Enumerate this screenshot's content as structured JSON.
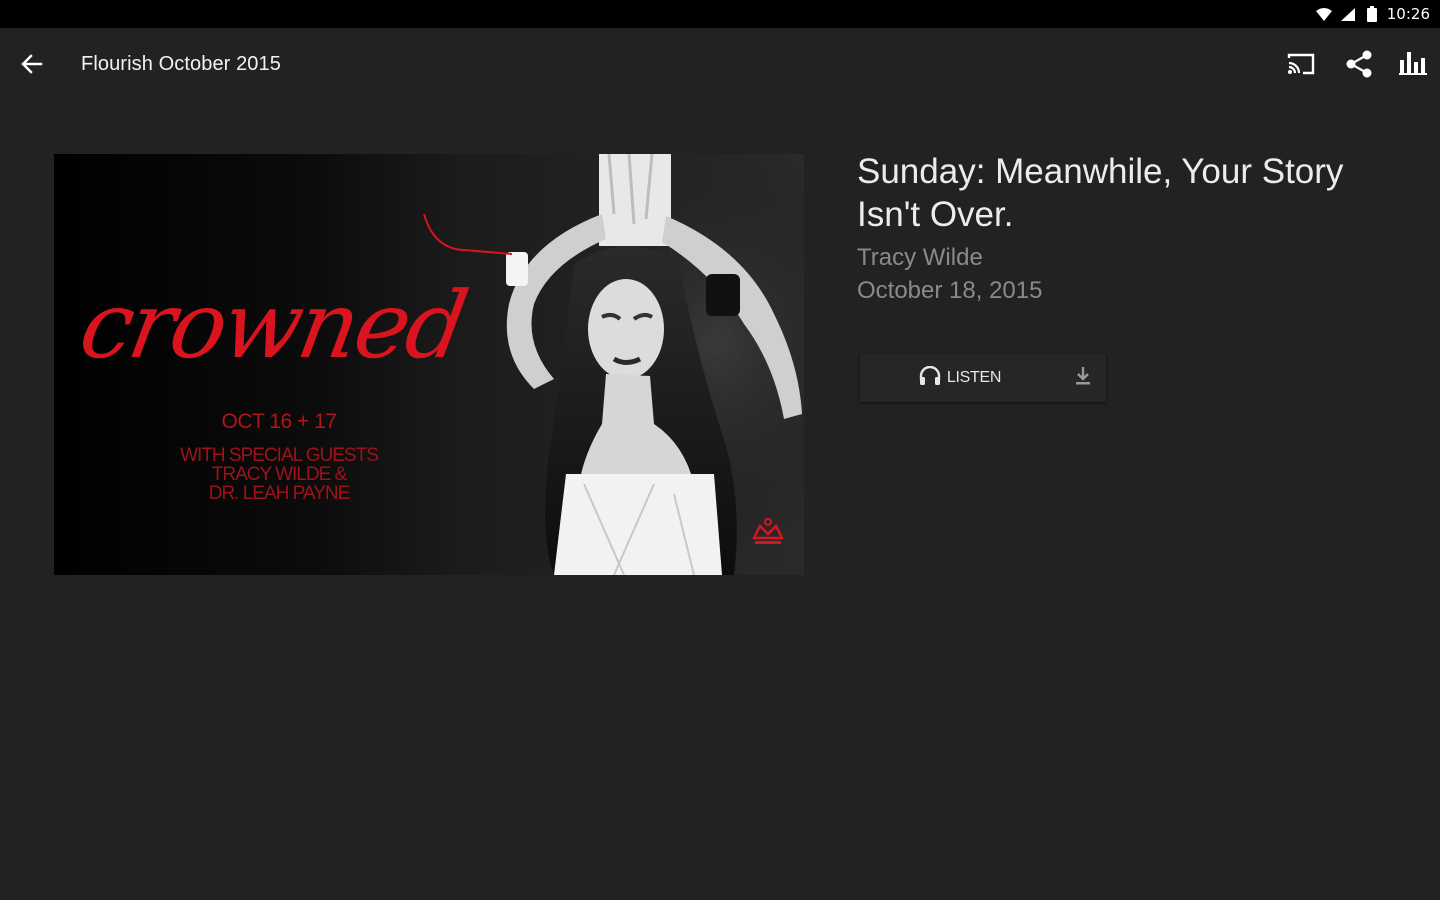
{
  "status_bar": {
    "time": "10:26",
    "icons": [
      "wifi-icon",
      "signal-icon",
      "battery-icon"
    ]
  },
  "toolbar": {
    "title": "Flourish October 2015",
    "back_icon": "arrow-left-icon",
    "actions": [
      "cast-icon",
      "share-icon",
      "bar-chart-icon"
    ]
  },
  "artwork": {
    "script_text": "crowned",
    "dates": "OCT 16 + 17",
    "guests_line1": "WITH SPECIAL GUESTS",
    "guests_line2": "TRACY WILDE &",
    "guests_line3": "DR. LEAH PAYNE",
    "accent_color": "#d9141e"
  },
  "sermon": {
    "title": "Sunday: Meanwhile, Your Story Isn't Over.",
    "speaker": "Tracy Wilde",
    "date": "October 18, 2015"
  },
  "media": {
    "listen_label": "LISTEN",
    "listen_icon": "headphones-icon",
    "download_icon": "download-icon"
  }
}
